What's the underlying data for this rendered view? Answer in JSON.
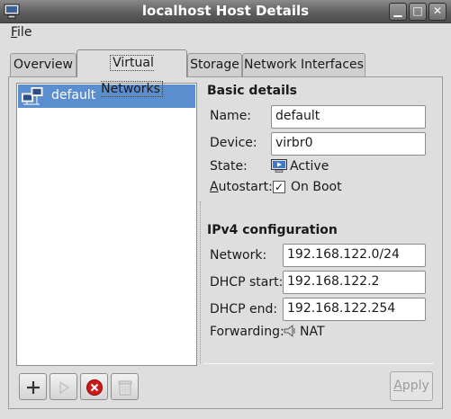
{
  "window": {
    "title": "localhost Host Details",
    "controls": {
      "minimize": "▁",
      "maximize": "□",
      "close": "✕"
    }
  },
  "menu": {
    "file_key": "F",
    "file_rest": "ile"
  },
  "tabs": [
    {
      "label": "Overview",
      "active": false
    },
    {
      "label": "Virtual Networks",
      "active": true
    },
    {
      "label": "Storage",
      "active": false
    },
    {
      "label": "Network Interfaces",
      "active": false
    }
  ],
  "networks": [
    {
      "name": "default",
      "selected": true,
      "icon": "network-icon"
    }
  ],
  "basic": {
    "heading": "Basic details",
    "name_label": "Name:",
    "name_value": "default",
    "device_label": "Device:",
    "device_value": "virbr0",
    "state_label": "State:",
    "state_value": "Active",
    "autostart_key": "A",
    "autostart_rest": "utostart:",
    "autostart_checked": true,
    "autostart_value": "On Boot"
  },
  "ipv4": {
    "heading": "IPv4 configuration",
    "network_label": "Network:",
    "network_value": "192.168.122.0/24",
    "dhcp_start_label": "DHCP start:",
    "dhcp_start_value": "192.168.122.2",
    "dhcp_end_label": "DHCP end:",
    "dhcp_end_value": "192.168.122.254",
    "forwarding_label": "Forwarding:",
    "forwarding_value": "NAT"
  },
  "apply": {
    "key": "A",
    "rest": "pply"
  },
  "colors": {
    "selection": "#5b8ecf",
    "delete_red": "#d01818",
    "window_bg": "#dedede"
  }
}
